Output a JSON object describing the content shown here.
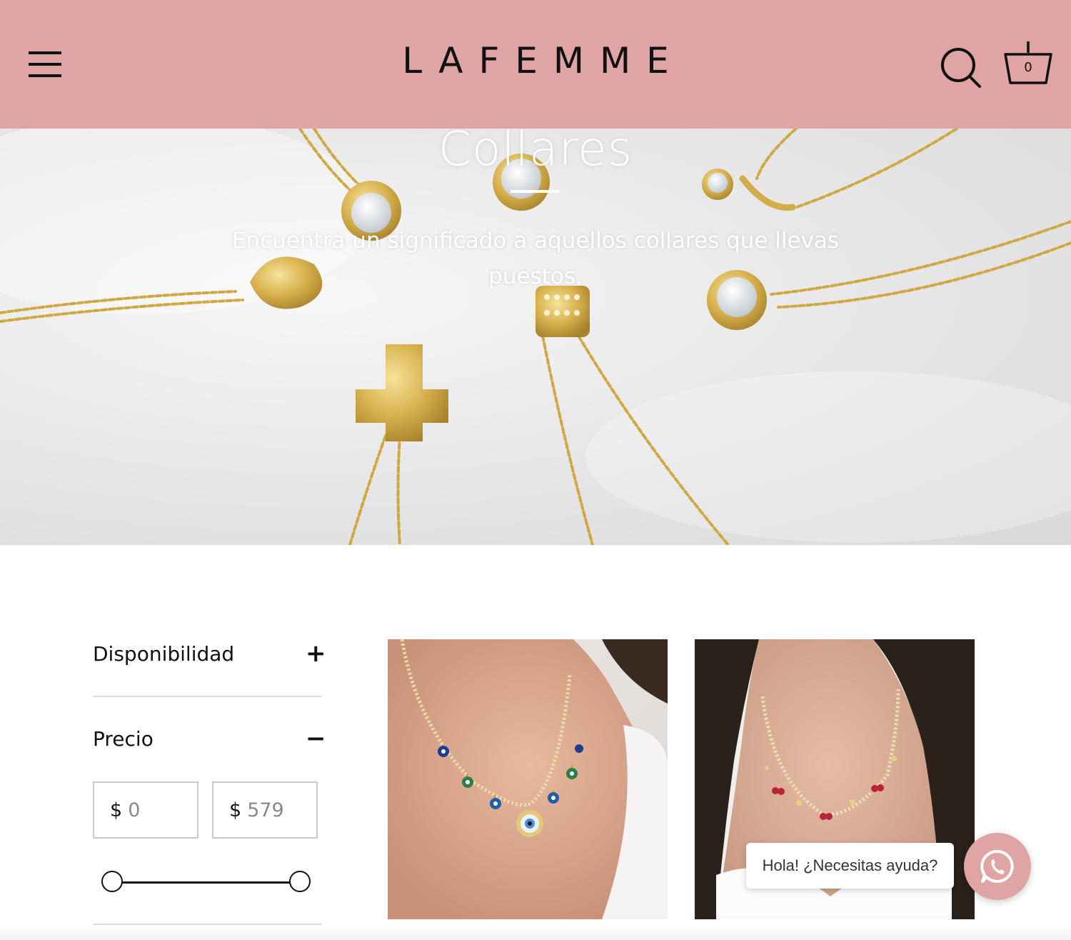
{
  "header": {
    "brand": "LAFEMME",
    "cart_count": "0",
    "background_color": "#e0a4a5",
    "icons": [
      "menu-icon",
      "search-icon",
      "cart-icon"
    ]
  },
  "hero": {
    "title": "Collares",
    "subtitle": "Encuentra un significado a aquellos collares que llevas puestos."
  },
  "filters": {
    "availability": {
      "label": "Disponibilidad",
      "toggle": "+"
    },
    "price": {
      "label": "Precio",
      "toggle": "−",
      "currency": "$",
      "min_placeholder": "0",
      "max_placeholder": "579",
      "range_min": 0,
      "range_max": 579
    }
  },
  "products": [
    {
      "description_icon": "evil-eye-necklace-image"
    },
    {
      "description_icon": "cherry-necklace-image"
    }
  ],
  "chat": {
    "bubble_text": "Hola! ¿Necesitas ayuda?",
    "button_color": "#e0a4a5",
    "icon": "whatsapp-icon"
  }
}
